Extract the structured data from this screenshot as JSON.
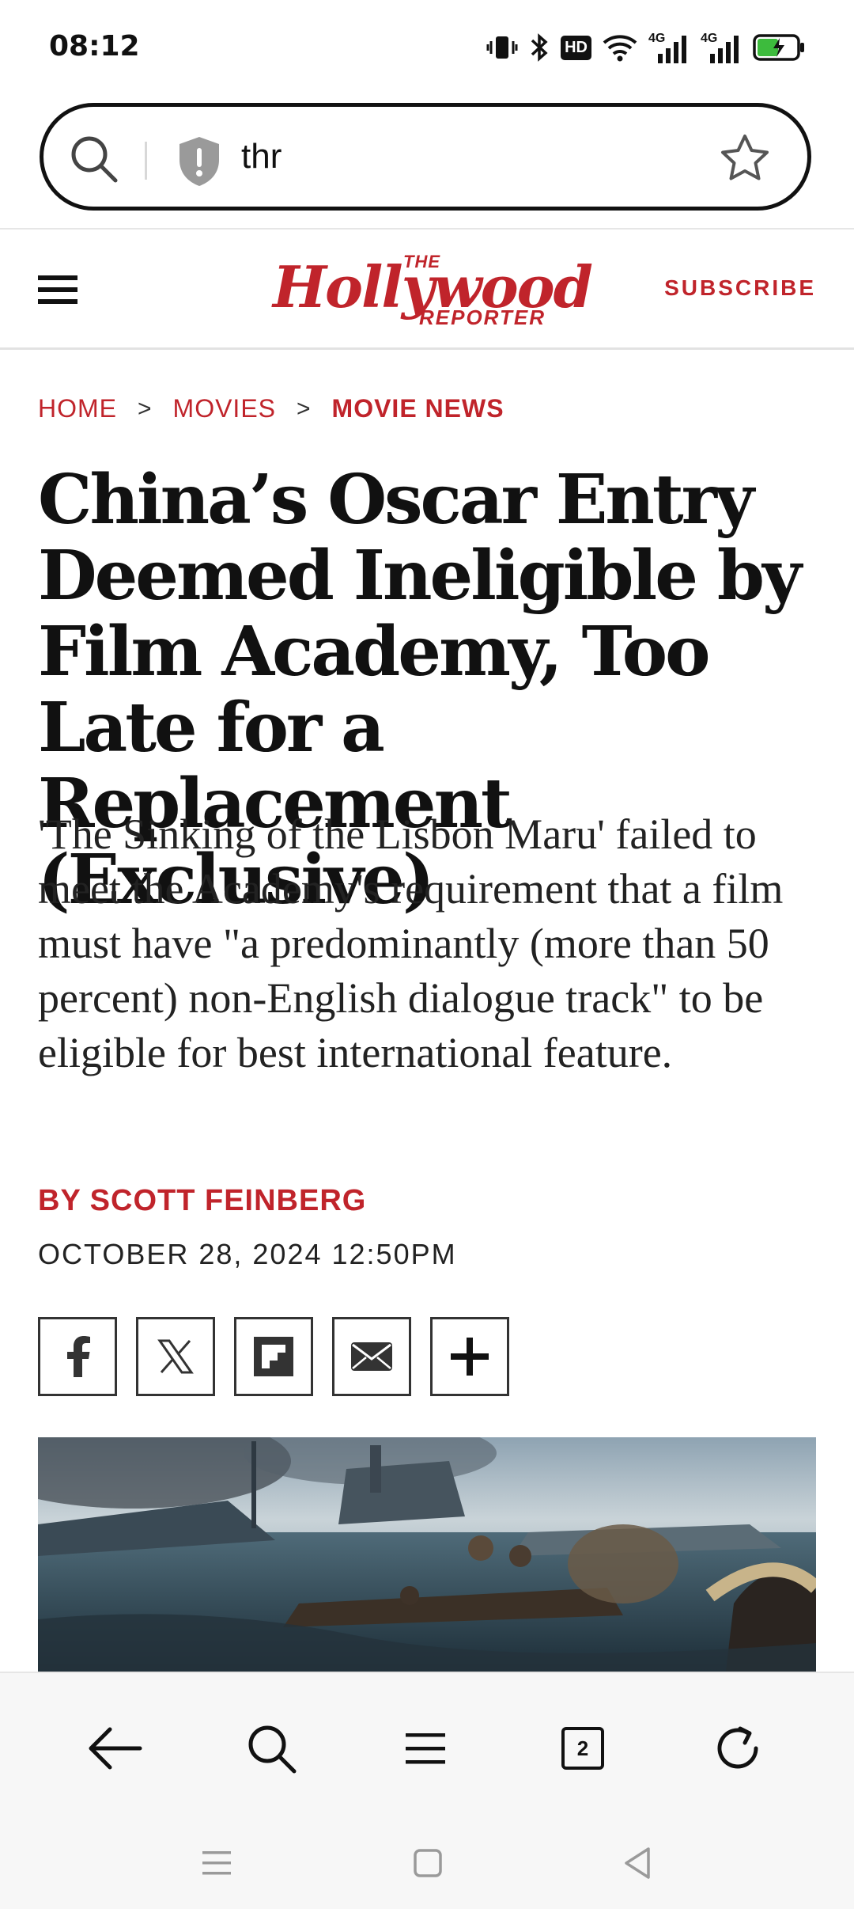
{
  "status_bar": {
    "time": "08:12",
    "icons": [
      "vibrate-icon",
      "bluetooth-icon",
      "hd-icon",
      "wifi-icon",
      "signal-4g-icon",
      "signal-4g-icon",
      "battery-charging-icon"
    ],
    "hd_label": "HD",
    "net_label": "4G"
  },
  "url_bar": {
    "text": "thr",
    "icons": [
      "search-icon",
      "shield-warning-icon",
      "star-icon"
    ]
  },
  "site_header": {
    "logo_the": "THE",
    "logo_main": "Hollywood",
    "logo_reporter": "REPORTER",
    "subscribe_label": "SUBSCRIBE"
  },
  "breadcrumb": {
    "items": [
      "HOME",
      "MOVIES",
      "MOVIE NEWS"
    ],
    "separator": ">"
  },
  "article": {
    "headline": "China’s Oscar Entry Deemed Ineligible by Film Academy, Too Late for a Replacement (Exclusive)",
    "dek": "'The Sinking of the Lisbon Maru' failed to meet the Academy's requirement that a film must have \"a predominantly (more than 50 percent) non-English dialogue track\" to be eligible for best international feature.",
    "byline": "BY SCOTT FEINBERG",
    "date": "OCTOBER 28, 2024 12:50PM"
  },
  "share_buttons": [
    "facebook-icon",
    "x-icon",
    "flipboard-icon",
    "email-icon",
    "plus-icon"
  ],
  "browser_toolbar": {
    "buttons": [
      "back-arrow-icon",
      "search-icon",
      "menu-icon",
      "tabs-icon",
      "reload-icon"
    ],
    "tab_count": "2"
  },
  "system_nav": [
    "recents-icon",
    "home-icon",
    "back-icon"
  ],
  "colors": {
    "brand_red": "#c0242b",
    "text": "#111111",
    "toolbar_bg": "#f7f7f7"
  }
}
